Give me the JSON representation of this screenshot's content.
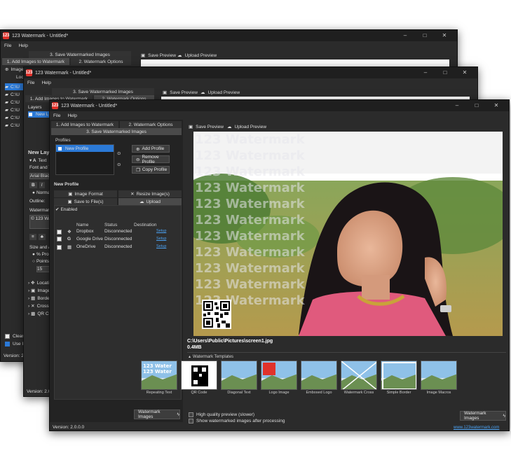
{
  "app": {
    "title": "123 Watermark - Untitled*",
    "logo": "123",
    "version": "Version: 2.0.0.0",
    "menu": [
      "File",
      "Help"
    ]
  },
  "tabs": {
    "add": "1. Add Images to Watermark",
    "options": "2. Watermark Options",
    "save": "3. Save Watermarked Images",
    "save_preview": "Save Preview",
    "upload_preview": "Upload Preview"
  },
  "back1": {
    "images_header": "Images",
    "locations_header": "Locati",
    "files": [
      "C:\\U",
      "C:\\U",
      "C:\\U",
      "C:\\U",
      "C:\\U",
      "C:\\U"
    ],
    "clear": "Clear Im",
    "use": "Use Ima",
    "version": "Version: 2.0.0.0"
  },
  "back2": {
    "layers": "Layers",
    "new_layer_item": "New L",
    "new_layer_heading": "New Layer",
    "text_row": "Text",
    "font_text": "Font and Tex",
    "font_name": "Arial Black",
    "normal": "Normal",
    "outline": "Outline:",
    "watermark": "Watermark T",
    "wm_value": "© 123 Wate",
    "size_angle": "Size and Ang",
    "proportional": "% Propor",
    "points": "Points",
    "size_value": "15",
    "sections": [
      "Locati",
      "Image",
      "Borde",
      "Cross",
      "QR Co"
    ],
    "version": "Version: 2.0.0.0"
  },
  "front": {
    "profiles_label": "Profiles",
    "profile_item": "New Profile",
    "add_profile": "Add Profile",
    "remove_profile": "Remove Profile",
    "copy_profile": "Copy Profile",
    "new_profile_heading": "New Profile",
    "subtabs": {
      "image_format": "Image Format",
      "resize": "Resize Image(s)",
      "save_to_file": "Save to File(s)",
      "upload": "Upload"
    },
    "enabled": "Enabled",
    "table_headers": [
      "Name",
      "Status",
      "Destination"
    ],
    "rows": [
      {
        "name": "Dropbox",
        "status": "Disconnected",
        "destination": "Setup"
      },
      {
        "name": "Google Drive",
        "status": "Disconnected",
        "destination": "Setup"
      },
      {
        "name": "OneDrive",
        "status": "Disconnected",
        "destination": "Setup"
      }
    ],
    "watermark_btn": "Watermark Images",
    "watermark_btn2": "Watermark Images",
    "preview_watermark": "123 Watermark",
    "file_path": "C:\\Users\\Public\\Pictures\\screen1.jpg",
    "file_size": "0.4MB",
    "templates_header": "Watermark Templates",
    "templates": [
      "Repeating Text",
      "QR Code",
      "Diagonal Text",
      "Logo Image",
      "Embosed Logo",
      "Watermark Cross",
      "Simple Border",
      "Image Macros"
    ],
    "hq_preview": "High quality preview (slower)",
    "show_after": "Show watermarked images after processing",
    "website": "www.123watermark.com",
    "version": "Version: 2.0.0.0"
  },
  "colors": {
    "accent": "#2b79d6",
    "brand": "#e0322b",
    "link": "#4aa0f0"
  }
}
